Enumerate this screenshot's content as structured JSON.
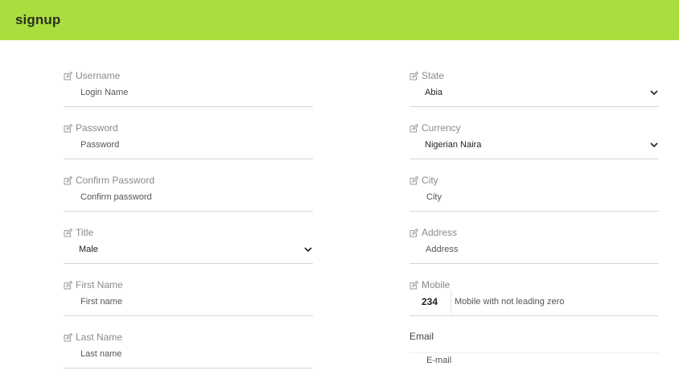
{
  "header": {
    "title": "signup",
    "color": "#aadd3e"
  },
  "form": {
    "left": [
      {
        "key": "username",
        "label": "Username",
        "placeholder": "Login Name",
        "type": "text",
        "icon": "edit-icon"
      },
      {
        "key": "password",
        "label": "Password",
        "placeholder": "Password",
        "type": "password",
        "icon": "edit-icon"
      },
      {
        "key": "confirm_password",
        "label": "Confirm Password",
        "placeholder": "Confirm password",
        "type": "password",
        "icon": "edit-icon"
      },
      {
        "key": "title",
        "label": "Title",
        "value": "Male",
        "type": "select",
        "icon": "edit-icon"
      },
      {
        "key": "first_name",
        "label": "First Name",
        "placeholder": "First name",
        "type": "text",
        "icon": "edit-icon"
      },
      {
        "key": "last_name",
        "label": "Last Name",
        "placeholder": "Last name",
        "type": "text",
        "icon": "edit-icon"
      }
    ],
    "right": [
      {
        "key": "state",
        "label": "State",
        "value": "Abia",
        "type": "select",
        "icon": "edit-icon"
      },
      {
        "key": "currency",
        "label": "Currency",
        "value": "Nigerian Naira",
        "type": "select",
        "icon": "edit-icon"
      },
      {
        "key": "city",
        "label": "City",
        "placeholder": "City",
        "type": "text",
        "icon": "edit-icon"
      },
      {
        "key": "address",
        "label": "Address",
        "placeholder": "Address",
        "type": "text",
        "icon": "edit-icon"
      },
      {
        "key": "mobile",
        "label": "Mobile",
        "country_code": "234",
        "placeholder": "Mobile with not leading zero",
        "type": "tel",
        "icon": "edit-icon"
      },
      {
        "key": "email",
        "label": "Email",
        "placeholder": "E-mail",
        "type": "email"
      }
    ]
  },
  "icons": {
    "edit": "edit-icon",
    "dropdown": "chevron-down-icon"
  }
}
